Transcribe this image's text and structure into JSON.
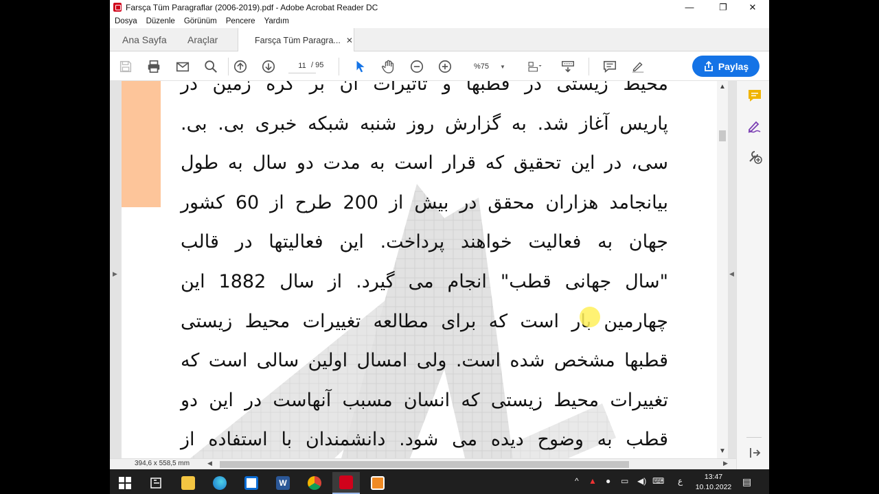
{
  "window": {
    "title": "Farsça Tüm Paragraflar (2006-2019).pdf - Adobe Acrobat Reader DC",
    "minimize": "—",
    "maximize": "❐",
    "close": "✕"
  },
  "menu": [
    "Dosya",
    "Düzenle",
    "Görünüm",
    "Pencere",
    "Yardım"
  ],
  "tabs": {
    "home": "Ana Sayfa",
    "tools": "Araçlar",
    "document": "Farsça Tüm Paragra...",
    "document_close": "✕"
  },
  "toolbar": {
    "page_current": "11",
    "page_total": "/  95",
    "zoom": "%75",
    "share_label": "Paylaş"
  },
  "document": {
    "lines": [
      "محیط زیستی در قطبها و تأثیرات آن بر کره زمین در",
      "پاریس آغاز شد. به گزارش روز شنبه شبکه خبری بی. بی.",
      "سی، در این تحقیق که قرار است به مدت دو سال به طول",
      "بیانجامد هزاران محقق در بیش از 200 طرح از 60 کشور",
      "جهان به فعالیت خواهند پرداخت. این فعالیتها در قالب",
      "\"سال جهانی قطب\" انجام می گیرد. از سال 1882 این",
      "چهارمین بار است که برای مطالعه تغییرات محیط زیستی",
      "قطبها مشخص شده است. ولی امسال اولین سالی است که",
      "تغییرات محیط زیستی که انسان مسبب آنهاست در این دو",
      "قطب به وضوح دیده می شود. دانشمندان با استفاده از"
    ]
  },
  "status": {
    "page_size": "394,6 x 558,5 mm"
  },
  "taskbar": {
    "clock_time": "13:47",
    "clock_date": "10.10.2022",
    "language": "ع"
  },
  "colors": {
    "accent": "#1473e6",
    "acrobat_red": "#d0021b",
    "orange_block": "#fdc59a",
    "comment_icon": "#f0b400",
    "sign_icon": "#7b3fb3"
  }
}
